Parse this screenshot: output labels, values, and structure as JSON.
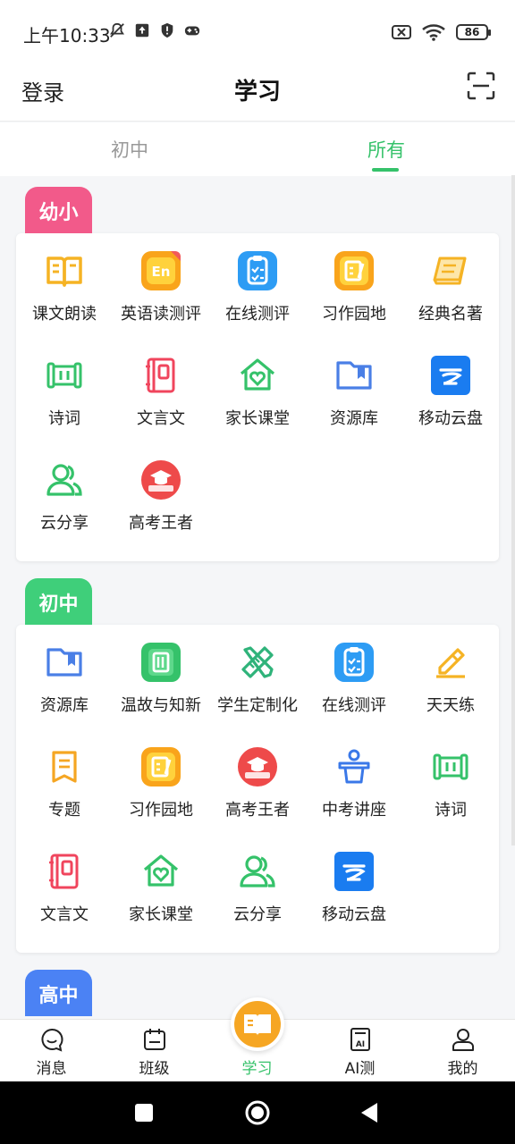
{
  "status_bar": {
    "time": "上午10:33",
    "battery": "86",
    "left_icons": [
      "mute-bell-icon",
      "upload-icon",
      "shield-alert-icon",
      "gamepad-icon"
    ],
    "right_icons": [
      "sim-off-icon",
      "wifi-icon",
      "battery-icon"
    ]
  },
  "top_nav": {
    "login": "登录",
    "title": "学习",
    "scan_icon": "scan-icon"
  },
  "level_tabs": [
    {
      "label": "初中",
      "active": false
    },
    {
      "label": "所有",
      "active": true
    }
  ],
  "colors": {
    "accent_green": "#35c26a",
    "badge_primary": "#f25a8a",
    "badge_junior": "#3fcf7a",
    "badge_senior": "#4b82f4",
    "fab_orange": "#f6a623"
  },
  "sections": [
    {
      "badge": "幼小",
      "items": [
        {
          "label": "课文朗读",
          "icon": "open-book-icon"
        },
        {
          "label": "英语读测评",
          "icon": "english-en-icon"
        },
        {
          "label": "在线测评",
          "icon": "clipboard-check-icon"
        },
        {
          "label": "习作园地",
          "icon": "writing-note-icon"
        },
        {
          "label": "经典名著",
          "icon": "classic-book-icon"
        },
        {
          "label": "诗词",
          "icon": "scroll-icon"
        },
        {
          "label": "文言文",
          "icon": "notebook-icon"
        },
        {
          "label": "家长课堂",
          "icon": "home-heart-icon"
        },
        {
          "label": "资源库",
          "icon": "folder-bookmark-icon"
        },
        {
          "label": "移动云盘",
          "icon": "cloud-drive-icon"
        },
        {
          "label": "云分享",
          "icon": "users-icon"
        },
        {
          "label": "高考王者",
          "icon": "graduation-cap-icon"
        }
      ]
    },
    {
      "badge": "初中",
      "items": [
        {
          "label": "资源库",
          "icon": "folder-bookmark-icon"
        },
        {
          "label": "温故与知新",
          "icon": "green-notebook-icon"
        },
        {
          "label": "学生定制化",
          "icon": "ruler-pencil-icon"
        },
        {
          "label": "在线测评",
          "icon": "clipboard-check-icon"
        },
        {
          "label": "天天练",
          "icon": "pencil-eraser-icon"
        },
        {
          "label": "专题",
          "icon": "topic-banner-icon"
        },
        {
          "label": "习作园地",
          "icon": "writing-note-icon"
        },
        {
          "label": "高考王者",
          "icon": "graduation-cap-icon"
        },
        {
          "label": "中考讲座",
          "icon": "podium-speaker-icon"
        },
        {
          "label": "诗词",
          "icon": "scroll-icon"
        },
        {
          "label": "文言文",
          "icon": "notebook-icon"
        },
        {
          "label": "家长课堂",
          "icon": "home-heart-icon"
        },
        {
          "label": "云分享",
          "icon": "users-icon"
        },
        {
          "label": "移动云盘",
          "icon": "cloud-drive-icon"
        }
      ]
    },
    {
      "badge": "高中",
      "items": []
    }
  ],
  "bottom_nav": [
    {
      "label": "消息",
      "icon": "chat-bubble-icon",
      "active": false
    },
    {
      "label": "班级",
      "icon": "calendar-class-icon",
      "active": false
    },
    {
      "label": "学习",
      "icon": "book-fab-icon",
      "active": true
    },
    {
      "label": "AI测",
      "icon": "ai-document-icon",
      "active": false
    },
    {
      "label": "我的",
      "icon": "profile-icon",
      "active": false
    }
  ],
  "system_nav": {
    "icons": [
      "recents-square-icon",
      "home-circle-icon",
      "back-triangle-icon"
    ]
  }
}
